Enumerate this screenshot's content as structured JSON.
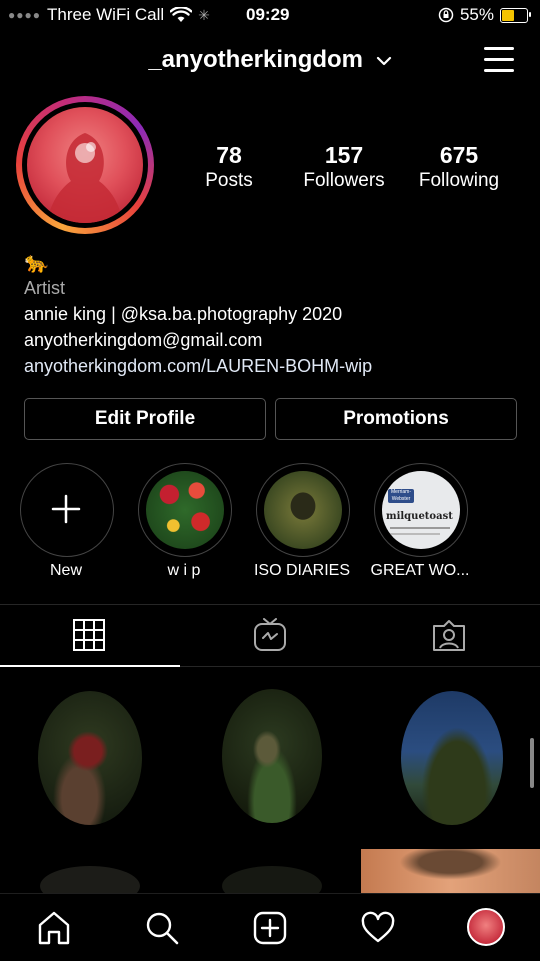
{
  "status": {
    "carrier": "Three WiFi Call",
    "time": "09:29",
    "battery": "55%",
    "battery_level": 0.55
  },
  "header": {
    "username": "_anyotherkingdom"
  },
  "stats": [
    {
      "value": "78",
      "label": "Posts"
    },
    {
      "value": "157",
      "label": "Followers"
    },
    {
      "value": "675",
      "label": "Following"
    }
  ],
  "bio": {
    "emoji": "🐆",
    "category": "Artist",
    "line1": "annie king | @ksa.ba.photography 2020",
    "email": "anyotherkingdom@gmail.com",
    "link": "anyotherkingdom.com/LAUREN-BOHM-wip"
  },
  "buttons": {
    "edit_profile": "Edit Profile",
    "promotions": "Promotions"
  },
  "highlights": [
    {
      "label": "New"
    },
    {
      "label": "w i p"
    },
    {
      "label": "ISO DIARIES"
    },
    {
      "label": "GREAT WO..."
    }
  ],
  "highlight_thumb_text": {
    "brand": "Merriam-Webster",
    "word": "milquetoast"
  },
  "icons": {
    "tabs": [
      "grid-icon",
      "igtv-icon",
      "tagged-icon"
    ],
    "nav": [
      "home-icon",
      "search-icon",
      "new-post-icon",
      "activity-heart-icon",
      "profile-avatar"
    ]
  }
}
